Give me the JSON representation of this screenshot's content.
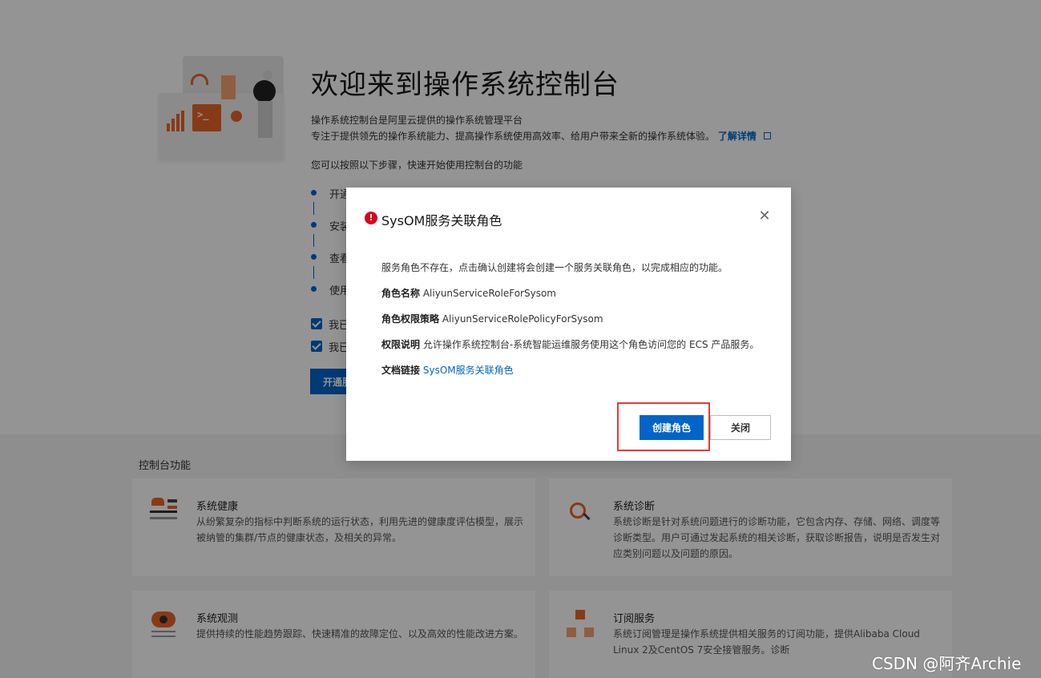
{
  "hero": {
    "title": "欢迎来到操作系统控制台",
    "desc_line1": "操作系统控制台是阿里云提供的操作系统管理平台",
    "desc_line2": "专注于提供领先的操作系统能力、提高操作系统使用高效率、给用户带来全新的操作系统体验。",
    "learn_more": "了解详情",
    "steps_intro": "您可以按照以下步骤，快速开始使用控制台的功能",
    "steps": [
      "开通",
      "安装",
      "查看",
      "使用"
    ],
    "checkboxes": [
      "我已",
      "我已"
    ],
    "open_button": "开通服"
  },
  "features": {
    "section_title": "控制台功能",
    "cards": [
      {
        "title": "系统健康",
        "desc": "从纷繁复杂的指标中判断系统的运行状态，利用先进的健康度评估模型，展示被纳管的集群/节点的健康状态，及相关的异常。",
        "icon": "health-icon"
      },
      {
        "title": "系统诊断",
        "desc": "系统诊断是针对系统问题进行的诊断功能，它包含内存、存储、网络、调度等诊断类型。用户可通过发起系统的相关诊断，获取诊断报告，说明是否发生对应类别问题以及问题的原因。",
        "icon": "diagnosis-icon"
      },
      {
        "title": "系统观测",
        "desc": "提供持续的性能趋势跟踪、快速精准的故障定位、以及高效的性能改进方案。",
        "icon": "observe-icon"
      },
      {
        "title": "订阅服务",
        "desc": "系统订阅管理是操作系统提供相关服务的订阅功能，提供Alibaba Cloud Linux 2及CentOS 7安全接管服务。诊断",
        "icon": "subscription-icon"
      }
    ]
  },
  "modal": {
    "title": "SysOM服务关联角色",
    "intro": "服务角色不存在，点击确认创建将会创建一个服务关联角色，以完成相应的功能。",
    "role_name_label": "角色名称",
    "role_name_value": "AliyunServiceRoleForSysom",
    "policy_label": "角色权限策略",
    "policy_value": "AliyunServiceRolePolicyForSysom",
    "permission_label": "权限说明",
    "permission_value": "允许操作系统控制台-系统智能运维服务使用这个角色访问您的 ECS 产品服务。",
    "doc_label": "文档链接",
    "doc_link": "SysOM服务关联角色",
    "create_button": "创建角色",
    "close_button": "关闭"
  },
  "watermark": "CSDN @阿齐Archie",
  "colors": {
    "primary": "#0064c8",
    "accent_orange": "#e8652a",
    "error_red": "#d9001b",
    "highlight_red": "#e13b3b"
  }
}
